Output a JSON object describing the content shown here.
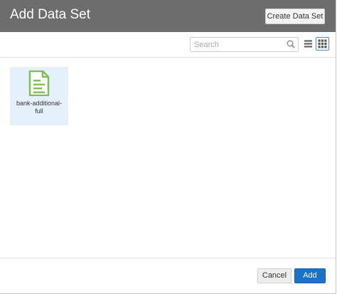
{
  "dialog": {
    "title": "Add Data Set",
    "create_button_label": "Create Data Set"
  },
  "toolbar": {
    "search_placeholder": "Search",
    "search_value": "",
    "list_view_icon": "list-view-icon",
    "grid_view_icon": "grid-view-icon",
    "selected_view": "grid"
  },
  "datasets": [
    {
      "name": "bank-additional-full",
      "icon": "file-document-icon",
      "selected": true
    }
  ],
  "footer": {
    "cancel_label": "Cancel",
    "add_label": "Add"
  },
  "colors": {
    "header_bg": "#6d6d6d",
    "tile_selected_bg": "#e5f1fa",
    "file_icon": "#7cbf55",
    "primary_button": "#1a73c9"
  }
}
